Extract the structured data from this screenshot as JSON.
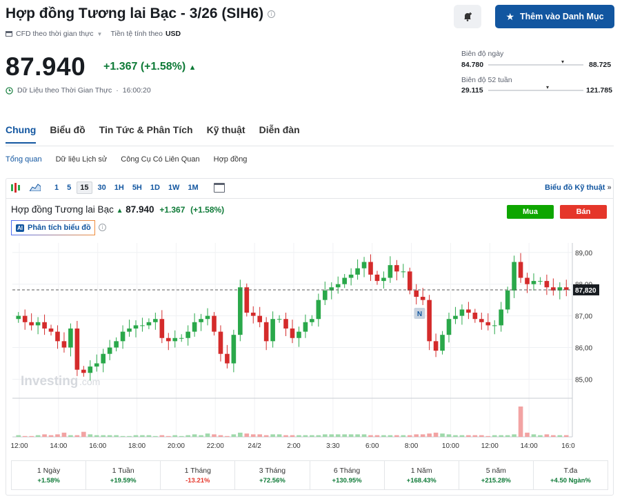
{
  "instrument": {
    "title": "Hợp đồng Tương lai Bạc - 3/26 (SIH6)",
    "data_type": "CFD theo thời gian thực",
    "currency_label": "Tiền tệ tính theo",
    "currency": "USD",
    "price": "87.940",
    "change": "+1.367 (+1.58%)",
    "realtime_label": "Dữ Liệu theo Thời Gian Thực",
    "time": "16:00:20"
  },
  "header_actions": {
    "watchlist_label": "Thêm vào Danh Mục"
  },
  "ranges": {
    "day": {
      "label": "Biên độ ngày",
      "low": "84.780",
      "high": "88.725",
      "position": 0.79
    },
    "week52": {
      "label": "Biên độ 52 tuần",
      "low": "29.115",
      "high": "121.785",
      "position": 0.63
    }
  },
  "tabs": [
    "Chung",
    "Biểu đồ",
    "Tin Tức & Phân Tích",
    "Kỹ thuật",
    "Diễn đàn"
  ],
  "subtabs": [
    "Tổng quan",
    "Dữ liệu Lịch sử",
    "Công Cụ Có Liên Quan",
    "Hợp đồng"
  ],
  "toolbar": {
    "timeframes": [
      "1",
      "5",
      "15",
      "30",
      "1H",
      "5H",
      "1D",
      "1W",
      "1M"
    ],
    "selected": "15",
    "technical_link": "Biểu đồ Kỹ thuật",
    "technical_chevron": "»"
  },
  "chart_header": {
    "name": "Hợp đồng Tương lai Bạc",
    "price": "87.940",
    "change": "+1.367",
    "change_pct": "(+1.58%)",
    "ai_badge": "AI",
    "ai_label": "Phân tích biểu đồ",
    "buy": "Mua",
    "sell": "Bán",
    "marker": "N",
    "watermark_main": "Investing",
    "watermark_suffix": ".com"
  },
  "colors": {
    "up": "#0e7a37",
    "down": "#e5362a",
    "candle_up": "#2aa84a",
    "candle_down": "#d42b2b",
    "accent": "#1256a0"
  },
  "chart_data": {
    "type": "candlestick",
    "x_tick_labels": [
      "12:00",
      "14:00",
      "16:00",
      "18:00",
      "20:00",
      "22:00",
      "24/2",
      "2:00",
      "3:30",
      "6:00",
      "8:00",
      "10:00",
      "12:00",
      "14:00",
      "16:0"
    ],
    "y_tick_labels": [
      "89,00",
      "88,00",
      "87,00",
      "86,00",
      "85,00"
    ],
    "ylim": [
      84.4,
      89.3
    ],
    "last_price_label": "87,820",
    "last_price": 87.82,
    "closes": [
      87.0,
      86.8,
      86.7,
      86.8,
      86.6,
      86.5,
      86.2,
      86.0,
      86.6,
      85.3,
      85.2,
      85.4,
      85.5,
      85.8,
      86.0,
      86.2,
      86.5,
      86.6,
      86.7,
      86.7,
      86.8,
      86.9,
      86.3,
      86.2,
      86.3,
      86.3,
      86.5,
      86.8,
      86.9,
      87.0,
      86.5,
      85.8,
      85.5,
      86.4,
      87.9,
      87.1,
      87.0,
      86.8,
      86.2,
      86.9,
      86.9,
      86.6,
      86.3,
      86.5,
      86.8,
      86.9,
      87.5,
      87.8,
      87.9,
      88.0,
      88.2,
      88.3,
      88.5,
      88.7,
      88.3,
      88.1,
      88.2,
      88.6,
      88.4,
      88.4,
      87.8,
      87.6,
      87.5,
      86.2,
      85.9,
      86.4,
      86.9,
      87.0,
      87.2,
      87.1,
      86.9,
      86.8,
      86.7,
      86.7,
      87.2,
      87.8,
      88.7,
      88.2,
      88.0,
      88.1,
      88.1,
      87.9,
      87.8,
      87.9,
      87.82
    ],
    "volumes": [
      2,
      1,
      1,
      2,
      3,
      2,
      3,
      5,
      2,
      2,
      6,
      3,
      2,
      2,
      2,
      2,
      1,
      1,
      2,
      2,
      2,
      1,
      2,
      1,
      2,
      1,
      2,
      3,
      2,
      4,
      3,
      2,
      1,
      3,
      5,
      4,
      3,
      3,
      2,
      3,
      3,
      2,
      2,
      2,
      2,
      2,
      2,
      3,
      3,
      3,
      3,
      3,
      3,
      3,
      2,
      2,
      2,
      2,
      2,
      2,
      2,
      3,
      3,
      4,
      5,
      4,
      3,
      2,
      2,
      2,
      2,
      2,
      1,
      2,
      2,
      2,
      3,
      36,
      5,
      3,
      2,
      3,
      2,
      2,
      2
    ]
  },
  "performance": [
    {
      "label": "1 Ngày",
      "value": "+1.58%",
      "dir": "up"
    },
    {
      "label": "1 Tuần",
      "value": "+19.59%",
      "dir": "up"
    },
    {
      "label": "1 Tháng",
      "value": "-13.21%",
      "dir": "down"
    },
    {
      "label": "3 Tháng",
      "value": "+72.56%",
      "dir": "up"
    },
    {
      "label": "6 Tháng",
      "value": "+130.95%",
      "dir": "up"
    },
    {
      "label": "1 Năm",
      "value": "+168.43%",
      "dir": "up"
    },
    {
      "label": "5 năm",
      "value": "+215.28%",
      "dir": "up"
    },
    {
      "label": "T.đa",
      "value": "+4.50 Ngàn%",
      "dir": "up"
    }
  ]
}
